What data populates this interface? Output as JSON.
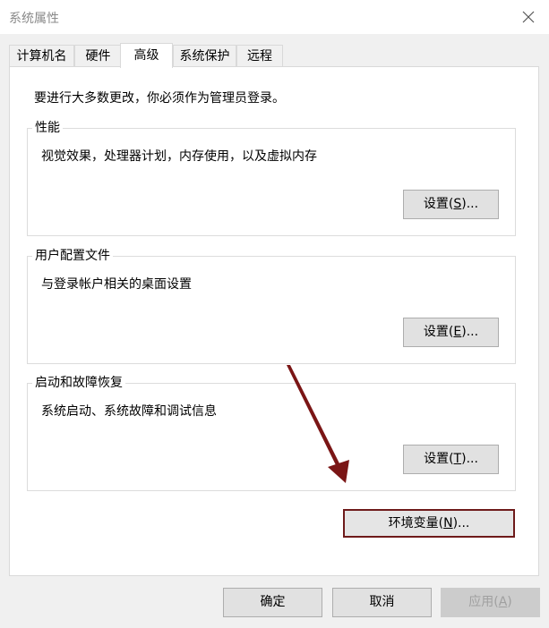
{
  "window": {
    "title": "系统属性"
  },
  "tabs": [
    {
      "label": "计算机名",
      "active": false
    },
    {
      "label": "硬件",
      "active": false
    },
    {
      "label": "高级",
      "active": true
    },
    {
      "label": "系统保护",
      "active": false
    },
    {
      "label": "远程",
      "active": false
    }
  ],
  "notice": "要进行大多数更改，你必须作为管理员登录。",
  "groups": {
    "performance": {
      "label": "性能",
      "description": "视觉效果，处理器计划，内存使用，以及虚拟内存",
      "button": {
        "pre": "设置(",
        "key": "S",
        "post": ")..."
      }
    },
    "user_profiles": {
      "label": "用户配置文件",
      "description": "与登录帐户相关的桌面设置",
      "button": {
        "pre": "设置(",
        "key": "E",
        "post": ")..."
      }
    },
    "startup_recovery": {
      "label": "启动和故障恢复",
      "description": "系统启动、系统故障和调试信息",
      "button": {
        "pre": "设置(",
        "key": "T",
        "post": ")..."
      }
    }
  },
  "env_button": {
    "pre": "环境变量(",
    "key": "N",
    "post": ")..."
  },
  "footer": {
    "ok": "确定",
    "cancel": "取消",
    "apply": {
      "pre": "应用(",
      "key": "A",
      "post": ")",
      "disabled": true
    }
  },
  "annotation": {
    "arrow_color": "#7a1515",
    "highlight_color": "#6e1a1a"
  }
}
